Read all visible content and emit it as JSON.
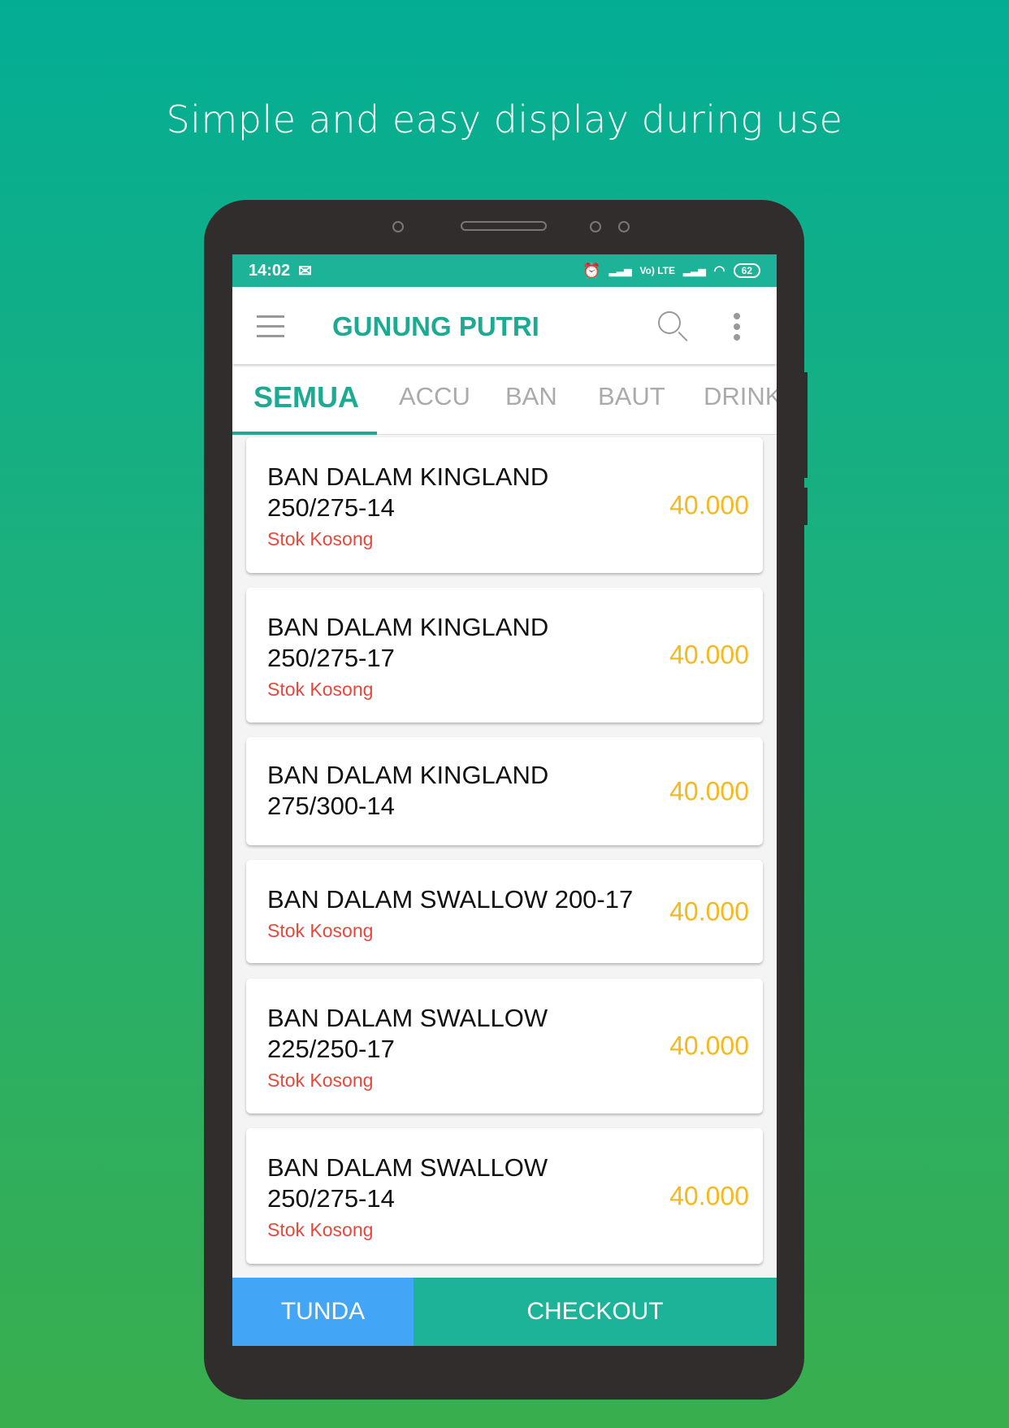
{
  "headline": "Simple and easy display during use",
  "status_bar": {
    "time": "14:02",
    "battery": "62",
    "network": "Vo) LTE"
  },
  "toolbar": {
    "title": "GUNUNG PUTRI"
  },
  "tabs": [
    {
      "label": "SEMUA",
      "active": true
    },
    {
      "label": "ACCU"
    },
    {
      "label": "BAN"
    },
    {
      "label": "BAUT"
    },
    {
      "label": "DRINK"
    }
  ],
  "products": [
    {
      "name": "BAN DALAM KINGLAND 250/275-14",
      "line1": "BAN DALAM KINGLAND",
      "line2": "250/275-14",
      "stock": "Stok Kosong",
      "price": "40.000"
    },
    {
      "name": "BAN DALAM KINGLAND 250/275-17",
      "line1": "BAN DALAM KINGLAND",
      "line2": "250/275-17",
      "stock": "Stok Kosong",
      "price": "40.000"
    },
    {
      "name": "BAN DALAM KINGLAND 275/300-14",
      "line1": "BAN DALAM KINGLAND",
      "line2": "275/300-14",
      "stock": "",
      "price": "40.000"
    },
    {
      "name": "BAN DALAM SWALLOW 200-17",
      "line1": "BAN DALAM SWALLOW 200-17",
      "line2": "",
      "stock": "Stok Kosong",
      "price": "40.000"
    },
    {
      "name": "BAN DALAM SWALLOW 225/250-17",
      "line1": "BAN DALAM SWALLOW",
      "line2": "225/250-17",
      "stock": "Stok Kosong",
      "price": "40.000"
    },
    {
      "name": "BAN DALAM SWALLOW 250/275-14",
      "line1": "BAN DALAM SWALLOW",
      "line2": "250/275-14",
      "stock": "Stok Kosong",
      "price": "40.000"
    }
  ],
  "actions": {
    "hold": "TUNDA",
    "checkout": "CHECKOUT"
  },
  "colors": {
    "primary": "#1db398",
    "hold": "#42a5f5",
    "price": "#f6b81c",
    "out_of_stock": "#e8473a"
  }
}
